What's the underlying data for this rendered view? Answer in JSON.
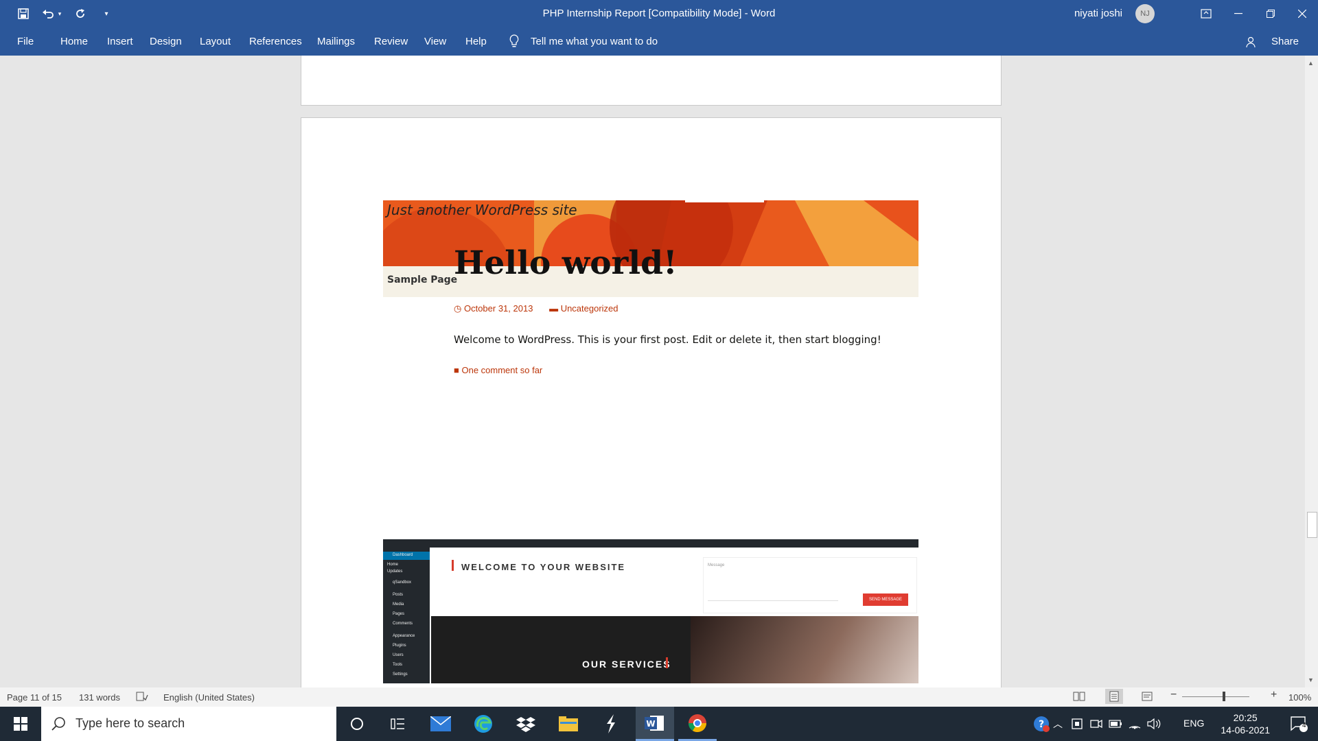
{
  "window": {
    "title": "PHP Internship Report [Compatibility Mode]  -  Word",
    "user_name": "niyati joshi",
    "user_initials": "NJ"
  },
  "quick_access": {
    "icons": [
      "save-icon",
      "undo-icon",
      "undo-dropdown-icon",
      "redo-icon",
      "customize-icon"
    ]
  },
  "ribbon": {
    "tabs": [
      "File",
      "Home",
      "Insert",
      "Design",
      "Layout",
      "References",
      "Mailings",
      "Review",
      "View",
      "Help"
    ],
    "tell_me": "Tell me what you want to do",
    "share": "Share"
  },
  "wp_page": {
    "tagline": "Just another WordPress site",
    "nav_link": "Sample Page",
    "post_title": "Hello world!",
    "date": "October 31, 2013",
    "category": "Uncategorized",
    "body": "Welcome to WordPress. This is your first post. Edit or delete it, then start blogging!",
    "comments": "One comment so far"
  },
  "dashboard": {
    "welcome": "WELCOME TO YOUR WEBSITE",
    "services": "OUR SERVICES",
    "send_button": "SEND MESSAGE",
    "message_placeholder": "Message",
    "menu": [
      "Dashboard",
      "Home",
      "Updates",
      "qSandbox",
      "Posts",
      "Media",
      "Pages",
      "Comments",
      "Appearance",
      "Plugins",
      "Users",
      "Tools",
      "Settings"
    ]
  },
  "status": {
    "page": "Page 11 of 15",
    "words": "131 words",
    "language": "English (United States)",
    "zoom": "100%"
  },
  "taskbar": {
    "search_placeholder": "Type here to search",
    "language": "ENG",
    "time": "20:25",
    "date": "14-06-2021",
    "notifications": "4"
  },
  "colors": {
    "word_blue": "#2b579a",
    "wp_accent": "#bc360a",
    "taskbar": "#1f2a36"
  }
}
